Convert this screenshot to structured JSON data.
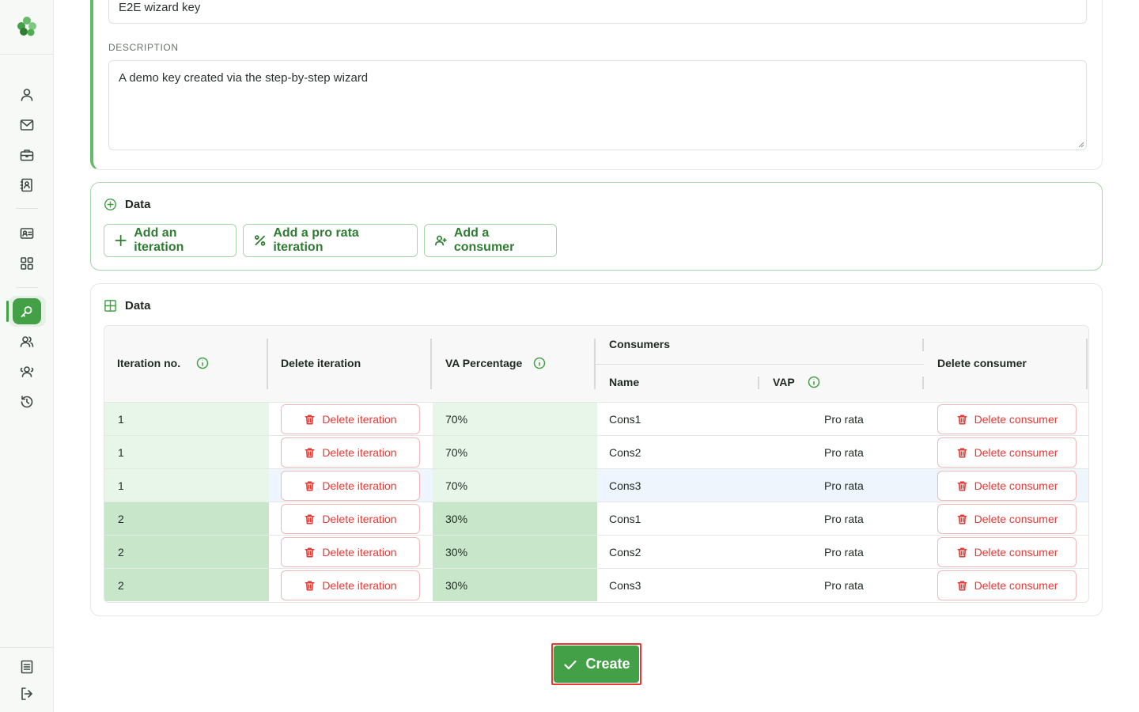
{
  "form": {
    "name_value": "E2E wizard key",
    "description_label": "DESCRIPTION",
    "description_value": "A demo key created via the step-by-step wizard"
  },
  "actions_section": {
    "title": "Data",
    "buttons": [
      {
        "label": "Add an iteration",
        "icon": "plus-icon"
      },
      {
        "label": "Add a pro rata iteration",
        "icon": "percent-icon"
      },
      {
        "label": "Add a consumer",
        "icon": "user-plus-icon"
      }
    ]
  },
  "table_section": {
    "title": "Data",
    "headers": {
      "iteration_no": "Iteration no.",
      "delete_iteration": "Delete iteration",
      "va_percentage": "VA Percentage",
      "consumers": "Consumers",
      "name": "Name",
      "vap": "VAP",
      "delete_consumer": "Delete consumer"
    },
    "rows": [
      {
        "iteration": "1",
        "delete_iteration": "Delete iteration",
        "va": "70%",
        "name": "Cons1",
        "vap": "Pro rata",
        "delete_consumer": "Delete consumer"
      },
      {
        "iteration": "1",
        "delete_iteration": "Delete iteration",
        "va": "70%",
        "name": "Cons2",
        "vap": "Pro rata",
        "delete_consumer": "Delete consumer"
      },
      {
        "iteration": "1",
        "delete_iteration": "Delete iteration",
        "va": "70%",
        "name": "Cons3",
        "vap": "Pro rata",
        "delete_consumer": "Delete consumer"
      },
      {
        "iteration": "2",
        "delete_iteration": "Delete iteration",
        "va": "30%",
        "name": "Cons1",
        "vap": "Pro rata",
        "delete_consumer": "Delete consumer"
      },
      {
        "iteration": "2",
        "delete_iteration": "Delete iteration",
        "va": "30%",
        "name": "Cons2",
        "vap": "Pro rata",
        "delete_consumer": "Delete consumer"
      },
      {
        "iteration": "2",
        "delete_iteration": "Delete iteration",
        "va": "30%",
        "name": "Cons3",
        "vap": "Pro rata",
        "delete_consumer": "Delete consumer"
      }
    ]
  },
  "create_button": {
    "label": "Create"
  },
  "sidebar": {
    "icons": [
      "user-icon",
      "mail-icon",
      "briefcase-icon",
      "contact-book-icon",
      "id-card-icon",
      "grid-icon",
      "key-search-icon",
      "users-icon",
      "users-alt-icon",
      "history-icon",
      "document-icon",
      "logout-icon"
    ],
    "active": "key-search-icon"
  },
  "colors": {
    "accent": "#43a047",
    "danger": "#e53935",
    "iter1_bg": "#e8f5e9",
    "iter2_bg": "#c8e6c9"
  }
}
